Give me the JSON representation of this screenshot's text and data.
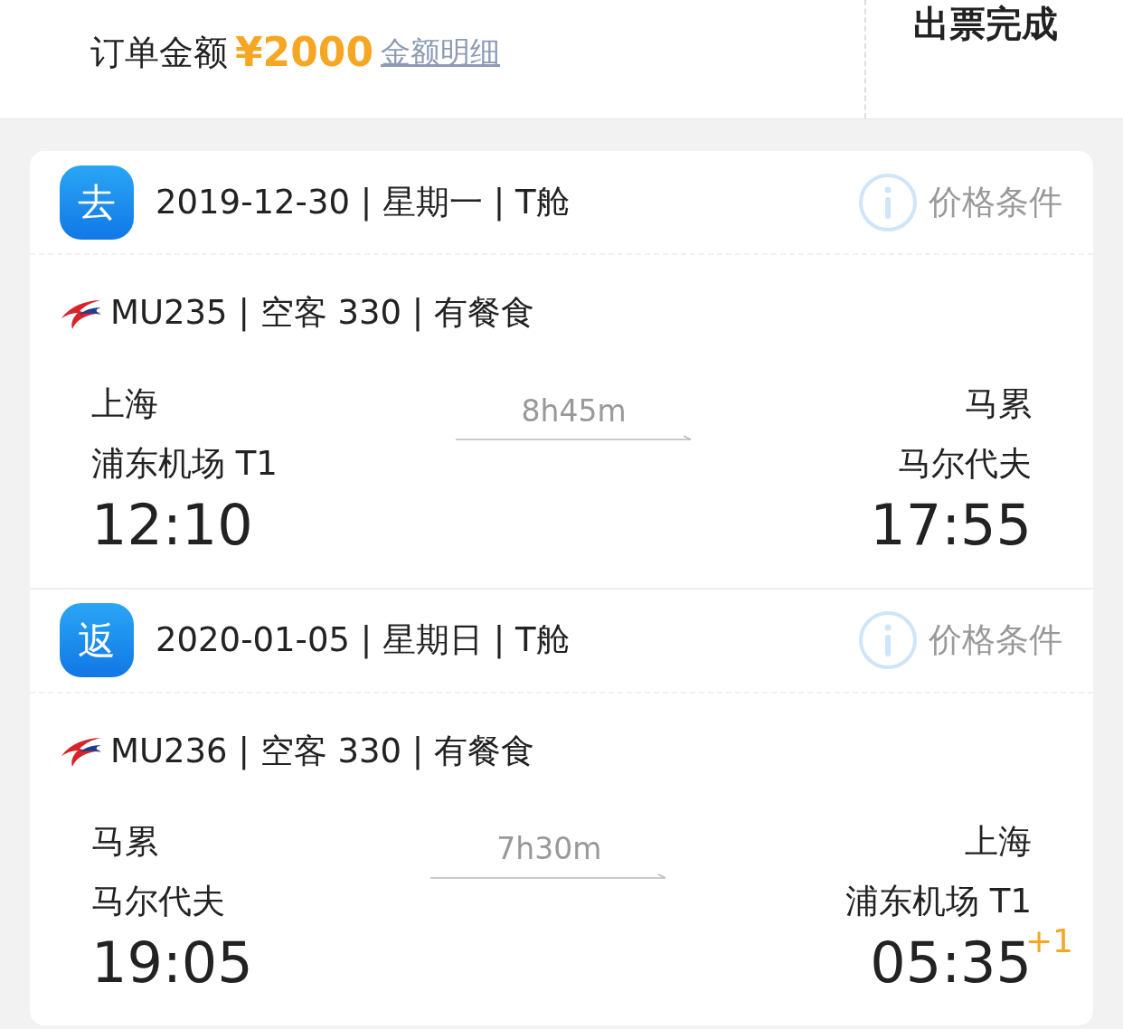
{
  "order": {
    "label": "订单金额",
    "amount": "¥2000",
    "detail_link": "金额明细"
  },
  "status": "出票完成",
  "segments": [
    {
      "badge": "去",
      "date_line": "2019-12-30 | 星期一 | T舱",
      "price_rules": "价格条件",
      "flight_line": "MU235 | 空客 330 | 有餐食",
      "duration": "8h45m",
      "departure": {
        "city": "上海",
        "airport": "浦东机场 T1",
        "time": "12:10"
      },
      "arrival": {
        "city": "马累",
        "airport": "马尔代夫",
        "time": "17:55"
      }
    },
    {
      "badge": "返",
      "date_line": "2020-01-05 | 星期日 | T舱",
      "price_rules": "价格条件",
      "flight_line": "MU236 | 空客 330 | 有餐食",
      "duration": "7h30m",
      "departure": {
        "city": "马累",
        "airport": "马尔代夫",
        "time": "19:05"
      },
      "arrival": {
        "city": "上海",
        "airport": "浦东机场 T1",
        "time": "05:35",
        "day_offset": "+1"
      }
    }
  ]
}
